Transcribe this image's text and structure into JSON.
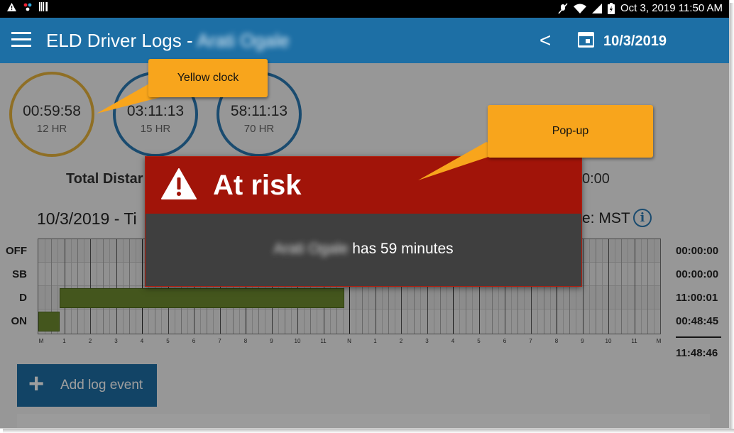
{
  "status_bar": {
    "left_icons": [
      "warning-icon",
      "app-icon",
      "barcode-icon"
    ],
    "right_icons": [
      "mute-icon",
      "wifi-icon",
      "signal-icon",
      "battery-icon"
    ],
    "datetime": "Oct 3, 2019 11:50 AM"
  },
  "appbar": {
    "title": "ELD Driver Logs -",
    "driver_name": "Arati Ogale",
    "date": "10/3/2019",
    "prev_glyph": "<"
  },
  "clocks": [
    {
      "time": "00:59:58",
      "label": "12 HR",
      "color": "#e7b43c"
    },
    {
      "time": "03:11:13",
      "label": "15 HR",
      "color": "#2a7ab4"
    },
    {
      "time": "58:11:13",
      "label": "70 HR",
      "color": "#2a7ab4"
    }
  ],
  "summary": {
    "total_distance_label": "Total Distar",
    "total_right": "0:00",
    "date_title": "10/3/2019 - Ti",
    "timezone": "e: MST"
  },
  "log_grid": {
    "rows": [
      {
        "label": "OFF",
        "total": "00:00:00"
      },
      {
        "label": "SB",
        "total": "00:00:00"
      },
      {
        "label": "D",
        "total": "11:00:01"
      },
      {
        "label": "ON",
        "total": "00:48:45"
      }
    ],
    "grand_total": "11:48:46",
    "hour_labels": [
      "M",
      "1",
      "2",
      "3",
      "4",
      "5",
      "6",
      "7",
      "8",
      "9",
      "10",
      "11",
      "N",
      "1",
      "2",
      "3",
      "4",
      "5",
      "6",
      "7",
      "8",
      "9",
      "10",
      "11",
      "M"
    ],
    "segments": [
      {
        "status": "ON",
        "start_hour": 0.0,
        "end_hour": 0.81
      },
      {
        "status": "D",
        "start_hour": 0.81,
        "end_hour": 11.81
      }
    ]
  },
  "add_button": {
    "plus": "+",
    "label": "Add log event"
  },
  "popup": {
    "title": "At risk",
    "message_name": "Arati Ogale",
    "message_rest": " has 59 minutes"
  },
  "callouts": {
    "yellow_clock": "Yellow clock",
    "popup": "Pop-up"
  },
  "colors": {
    "appbar": "#1d6fa5",
    "popup_header": "#a11409",
    "popup_body": "#3f3f3f",
    "callout": "#f8a51c",
    "drive_segment": "#6e8c2f"
  }
}
